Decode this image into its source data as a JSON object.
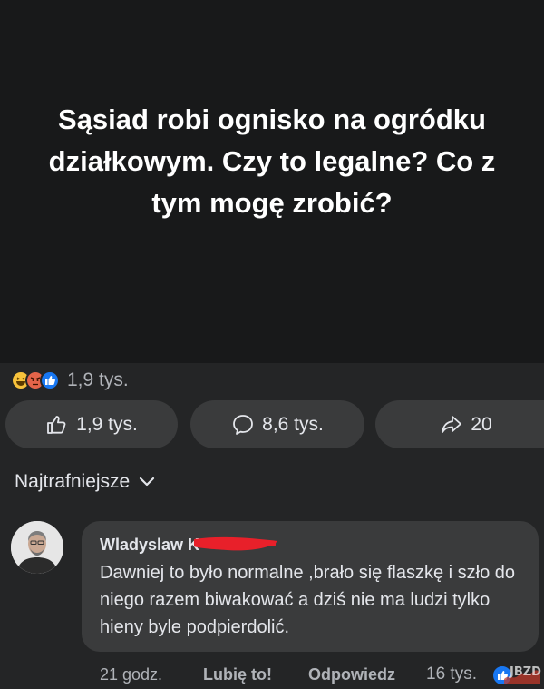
{
  "post": {
    "title": "Sąsiad robi ognisko na ogródku działkowym. Czy to legalne? Co z tym mogę zrobić?"
  },
  "reactions": {
    "icons": [
      "haha-emoji-icon",
      "angry-emoji-icon",
      "like-icon"
    ],
    "count": "1,9 tys."
  },
  "actions": {
    "like_count": "1,9 tys.",
    "comment_count": "8,6 tys.",
    "share_count": "20"
  },
  "sort": {
    "label": "Najtrafniejsze"
  },
  "comment": {
    "author": "Wladyslaw K",
    "text": "Dawniej to było normalne ,brało się flaszkę i szło do niego razem biwakować a dziś nie ma ludzi tylko hieny byle podpierdolić.",
    "time": "21 godz.",
    "like_label": "Lubię to!",
    "reply_label": "Odpowiedz",
    "reaction_count": "16 tys."
  },
  "watermark": {
    "text": "JBZD"
  },
  "colors": {
    "background": "#242526",
    "banner": "#18191a",
    "button": "#3a3b3c",
    "like_blue": "#1877f2",
    "redaction_red": "#e8202a"
  }
}
